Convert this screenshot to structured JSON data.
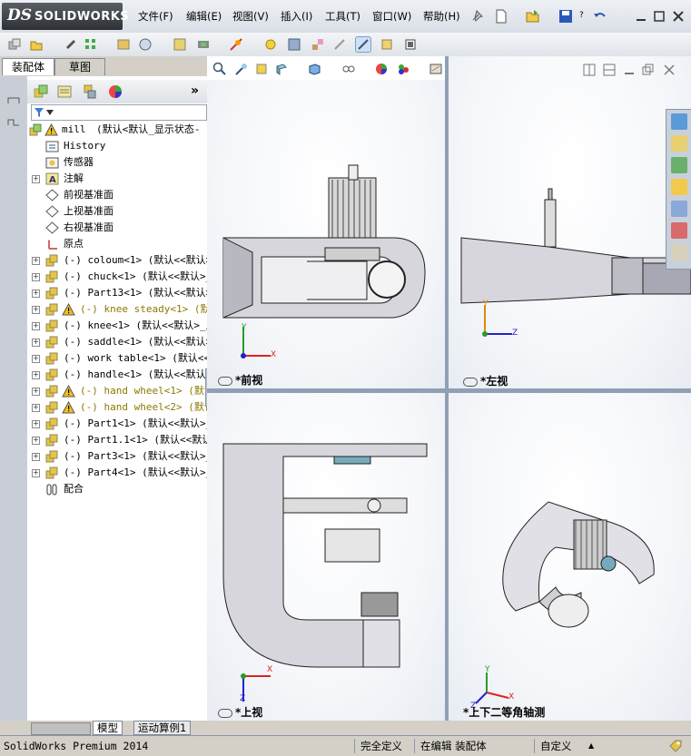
{
  "app": {
    "logo_ds": "DS",
    "logo_text": "SOLIDWORKS",
    "menus": [
      "文件(F)",
      "编辑(E)",
      "视图(V)",
      "插入(I)",
      "工具(T)",
      "窗口(W)",
      "帮助(H)"
    ],
    "help_suffix": "?"
  },
  "panel_tabs": {
    "assembly": "装配体",
    "sketch": "草图"
  },
  "tree": {
    "root_name": "mill",
    "root_config": "(默认<默认_显示状态-",
    "items": [
      {
        "label": "History",
        "mono": true
      },
      {
        "label": "传感器"
      },
      {
        "label": "注解"
      },
      {
        "label": "前视基准面"
      },
      {
        "label": "上视基准面"
      },
      {
        "label": "右视基准面"
      },
      {
        "label": "原点"
      },
      {
        "label": "(-) coloum<1> (默认<<默认>_显"
      },
      {
        "label": "(-) chuck<1> (默认<<默认>_显"
      },
      {
        "label": "(-) Part13<1> (默认<<默认>_"
      },
      {
        "label": "(-) knee steady<1> (默认<<"
      },
      {
        "label": "(-) knee<1> (默认<<默认>_显示"
      },
      {
        "label": "(-) saddle<1> (默认<<默认>_"
      },
      {
        "label": "(-) work table<1> (默认<<默"
      },
      {
        "label": "(-) handle<1> (默认<<默认>_"
      },
      {
        "label": "(-) hand wheel<1> (默认<<"
      },
      {
        "label": "(-) hand wheel<2> (默认<<"
      },
      {
        "label": "(-) Part1<1> (默认<<默认>_显"
      },
      {
        "label": "(-) Part1.1<1> (默认<<默认>"
      },
      {
        "label": "(-) Part3<1> (默认<<默认>_显"
      },
      {
        "label": "(-) Part4<1> (默认<<默认>_显"
      },
      {
        "label": "配合"
      }
    ]
  },
  "viewports": {
    "front": "*前视",
    "left": "*左视",
    "top": "*上视",
    "iso": "*上下二等角轴测"
  },
  "axes": {
    "x": "X",
    "y": "Y",
    "z": "Z"
  },
  "bottom_tabs": {
    "model": "模型",
    "motion": "运动算例1"
  },
  "status": {
    "product": "SolidWorks Premium 2014",
    "definition": "完全定义",
    "editing": "在编辑 装配体",
    "custom": "自定义",
    "arrow": "▲"
  },
  "colors": {
    "accent": "#1f4e9a",
    "warning": "#f0c020",
    "part_gray": "#c8c8c8",
    "viewport_bg": "#f5f7fa"
  }
}
